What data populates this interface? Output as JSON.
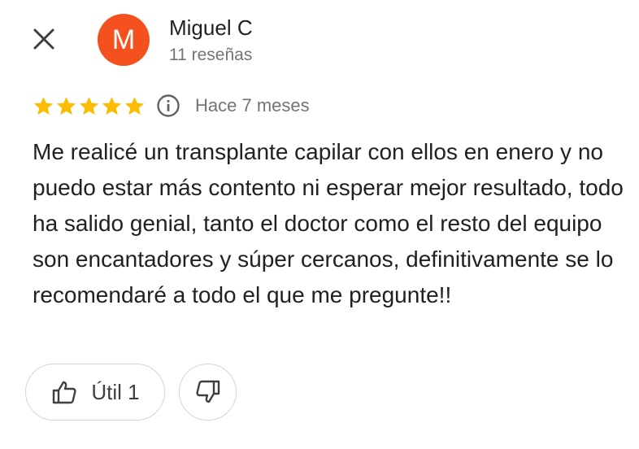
{
  "reviewer": {
    "initial": "M",
    "name": "Miguel C",
    "meta": "11 reseñas",
    "avatar_color": "#f4511e"
  },
  "review": {
    "rating": 5,
    "max_rating": 5,
    "date": "Hace 7 meses",
    "text": "Me realicé un transplante capilar con ellos en enero y no puedo estar más contento ni esperar mejor resultado, todo ha salido genial, tanto el doctor como el resto del equipo son encantadores y súper cercanos, definitivamente se lo recomendaré a todo el que me pregunte!!"
  },
  "actions": {
    "helpful_label": "Útil 1"
  },
  "icons": {
    "close": "close-icon",
    "star": "star-icon",
    "info": "info-icon",
    "thumb_up": "thumb-up-icon",
    "thumb_down": "thumb-down-icon"
  },
  "colors": {
    "star": "#fbbc04",
    "secondary_text": "#70757a",
    "primary_text": "#202124",
    "border": "#d2d5d9"
  }
}
